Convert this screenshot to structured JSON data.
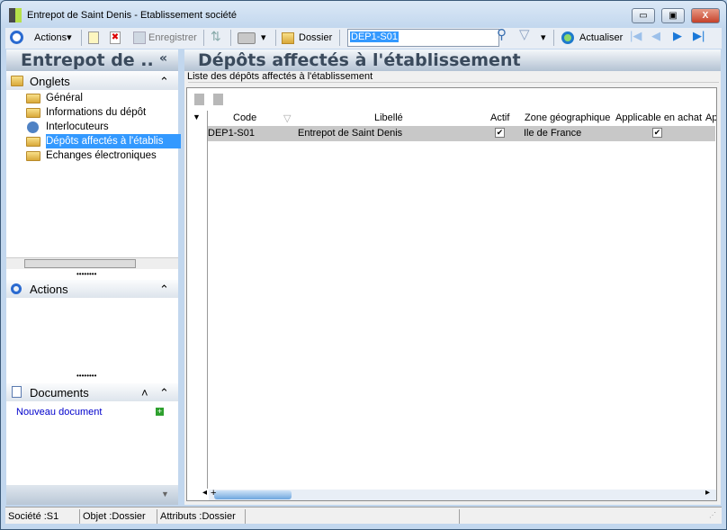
{
  "window": {
    "title": "Entrepot de  Saint  Denis -  Etablissement société",
    "min": "▭",
    "max": "▣",
    "close": "X"
  },
  "toolbar": {
    "actions": "Actions",
    "save": "Enregistrer",
    "dossier": "Dossier",
    "search_value": "DEP1-S01",
    "refresh": "Actualiser"
  },
  "left": {
    "title": "Entrepot de  ..",
    "collapse": "«",
    "onglets": "Onglets",
    "tabs": [
      "Général",
      "Informations du dépôt",
      "Interlocuteurs",
      "Dépôts affectés à l'établis",
      "Echanges électroniques"
    ],
    "actions": "Actions",
    "documents": "Documents",
    "new_document": "Nouveau document"
  },
  "main": {
    "title": "Dépôts affectés à l'établissement",
    "group_label": "Liste des dépôts affectés à l'établissement",
    "columns": [
      "Code",
      "Libellé",
      "Actif",
      "Zone géographique",
      "Applicable en achat",
      "Ap"
    ],
    "rows": [
      {
        "code": "DEP1-S01",
        "libelle": "Entrepot de  Saint  Denis",
        "actif": true,
        "zone": "Ile de France",
        "achat": true
      }
    ]
  },
  "status": {
    "societe": "Société :S1",
    "objet": "Objet :Dossier",
    "attributs": "Attributs :Dossier"
  },
  "colors": {
    "selection": "#3399ff",
    "row_selected": "#c8c8c8",
    "link": "#0000cc"
  }
}
